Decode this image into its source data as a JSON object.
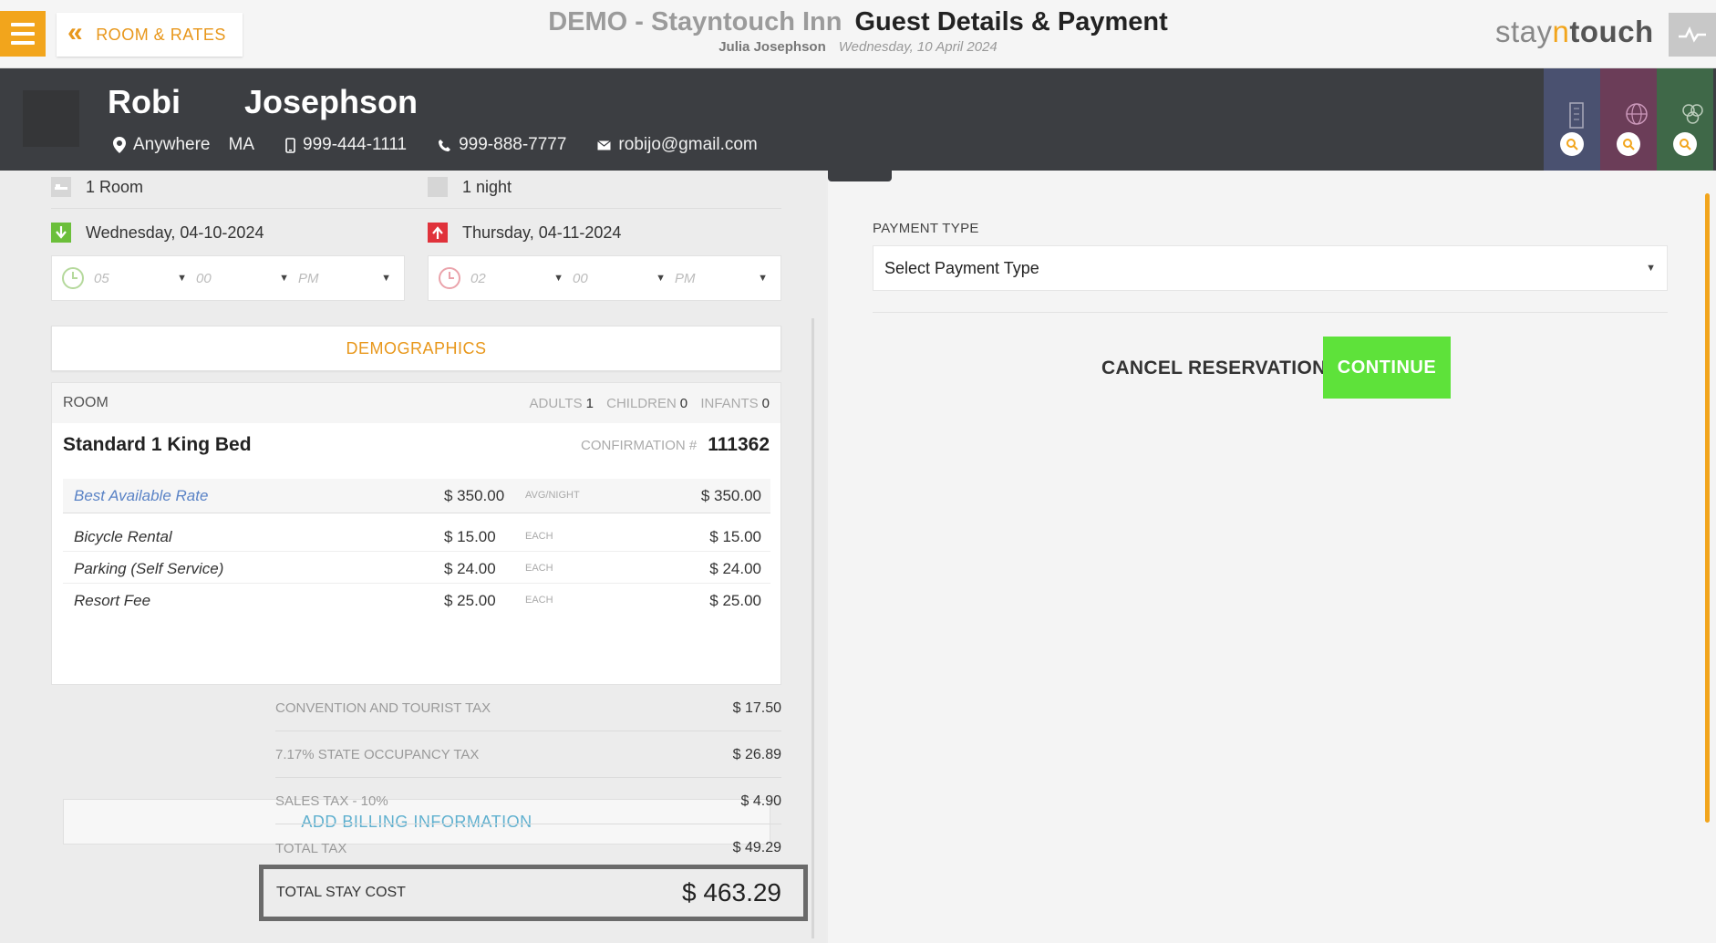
{
  "topbar": {
    "back_label": "ROOM & RATES",
    "hotel_name": "DEMO - Stayntouch Inn",
    "page_title": "Guest Details & Payment",
    "user_name": "Julia Josephson",
    "business_date": "Wednesday, 10 April 2024",
    "brand": {
      "part1": "stay",
      "part2": "n",
      "part3": "touch"
    },
    "accent_color": "#f2a51c"
  },
  "guest": {
    "first_name": "Robi",
    "last_name": "Josephson",
    "city": "Anywhere",
    "state": "MA",
    "mobile": "999-444-1111",
    "phone": "999-888-7777",
    "email": "robijo@gmail.com",
    "side_tabs": [
      {
        "icon": "building-icon",
        "color": "#4a5170"
      },
      {
        "icon": "globe-icon",
        "color": "#6b3d58"
      },
      {
        "icon": "group-icon",
        "color": "#3f6848"
      }
    ]
  },
  "stay": {
    "rooms": "1 Room",
    "nights": "1 night",
    "arrival_date": "Wednesday, 04-10-2024",
    "departure_date": "Thursday, 04-11-2024",
    "arrival_time": {
      "hour": "05",
      "minute": "00",
      "ampm": "PM"
    },
    "departure_time": {
      "hour": "02",
      "minute": "00",
      "ampm": "PM"
    }
  },
  "demographics_label": "DEMOGRAPHICS",
  "room": {
    "header_label": "ROOM",
    "adults_label": "ADULTS",
    "adults": "1",
    "children_label": "CHILDREN",
    "children": "0",
    "infants_label": "INFANTS",
    "infants": "0",
    "type": "Standard 1 King Bed",
    "confirmation_label": "CONFIRMATION #",
    "confirmation": "111362",
    "rate": {
      "name": "Best Available Rate",
      "price": "$ 350.00",
      "unit": "AVG/NIGHT",
      "total": "$ 350.00"
    },
    "addons": [
      {
        "name": "Bicycle Rental",
        "price": "$ 15.00",
        "unit": "EACH",
        "total": "$ 15.00"
      },
      {
        "name": "Parking (Self Service)",
        "price": "$ 24.00",
        "unit": "EACH",
        "total": "$ 24.00"
      },
      {
        "name": "Resort Fee",
        "price": "$ 25.00",
        "unit": "EACH",
        "total": "$ 25.00"
      }
    ],
    "billing_label": "ADD BILLING INFORMATION"
  },
  "taxes": [
    {
      "label": "CONVENTION AND TOURIST TAX",
      "amount": "$ 17.50"
    },
    {
      "label": "7.17% STATE OCCUPANCY TAX",
      "amount": "$ 26.89"
    },
    {
      "label": "SALES TAX - 10%",
      "amount": "$ 4.90"
    },
    {
      "label": "TOTAL TAX",
      "amount": "$ 49.29"
    }
  ],
  "total": {
    "label": "TOTAL STAY COST",
    "amount": "$ 463.29"
  },
  "payment": {
    "type_label": "PAYMENT TYPE",
    "select_value": "Select Payment Type",
    "cancel_label": "CANCEL RESERVATION",
    "continue_label": "CONTINUE",
    "continue_color": "#5ee23a"
  }
}
